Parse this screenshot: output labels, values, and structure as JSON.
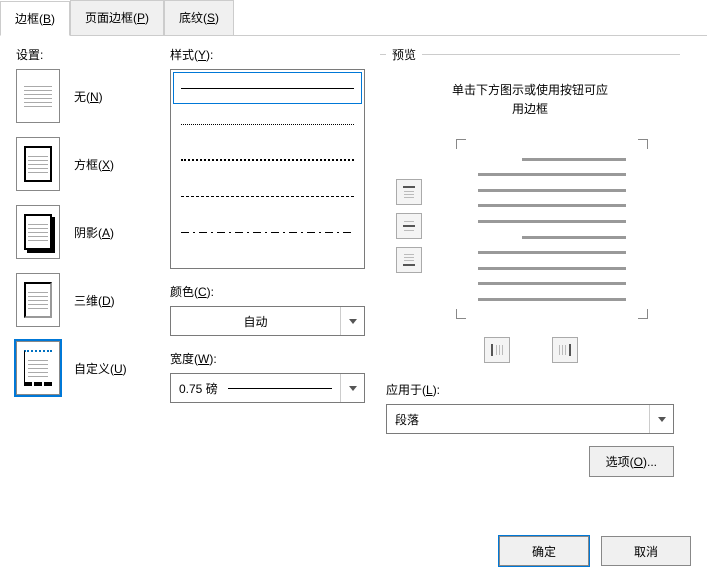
{
  "tabs": [
    {
      "label": "边框(",
      "key": "B",
      "suffix": ")",
      "active": true
    },
    {
      "label": "页面边框(",
      "key": "P",
      "suffix": ")",
      "active": false
    },
    {
      "label": "底纹(",
      "key": "S",
      "suffix": ")",
      "active": false
    }
  ],
  "settings": {
    "label": "设置:",
    "items": [
      {
        "label": "无(",
        "key": "N",
        "suffix": ")",
        "type": "none"
      },
      {
        "label": "方框(",
        "key": "X",
        "suffix": ")",
        "type": "box"
      },
      {
        "label": "阴影(",
        "key": "A",
        "suffix": ")",
        "type": "shadow"
      },
      {
        "label": "三维(",
        "key": "D",
        "suffix": ")",
        "type": "3d"
      },
      {
        "label": "自定义(",
        "key": "U",
        "suffix": ")",
        "type": "custom",
        "selected": true
      }
    ]
  },
  "style": {
    "label": "样式(",
    "key": "Y",
    "suffix": "):"
  },
  "color": {
    "label": "颜色(",
    "key": "C",
    "suffix": "):",
    "value": "自动"
  },
  "width": {
    "label": "宽度(",
    "key": "W",
    "suffix": "):",
    "value": "0.75 磅"
  },
  "preview": {
    "label": "预览",
    "hint1": "单击下方图示或使用按钮可应",
    "hint2": "用边框"
  },
  "apply": {
    "label": "应用于(",
    "key": "L",
    "suffix": "):",
    "value": "段落"
  },
  "options": {
    "label": "选项(",
    "key": "O",
    "suffix": ")..."
  },
  "buttons": {
    "ok": "确定",
    "cancel": "取消"
  }
}
